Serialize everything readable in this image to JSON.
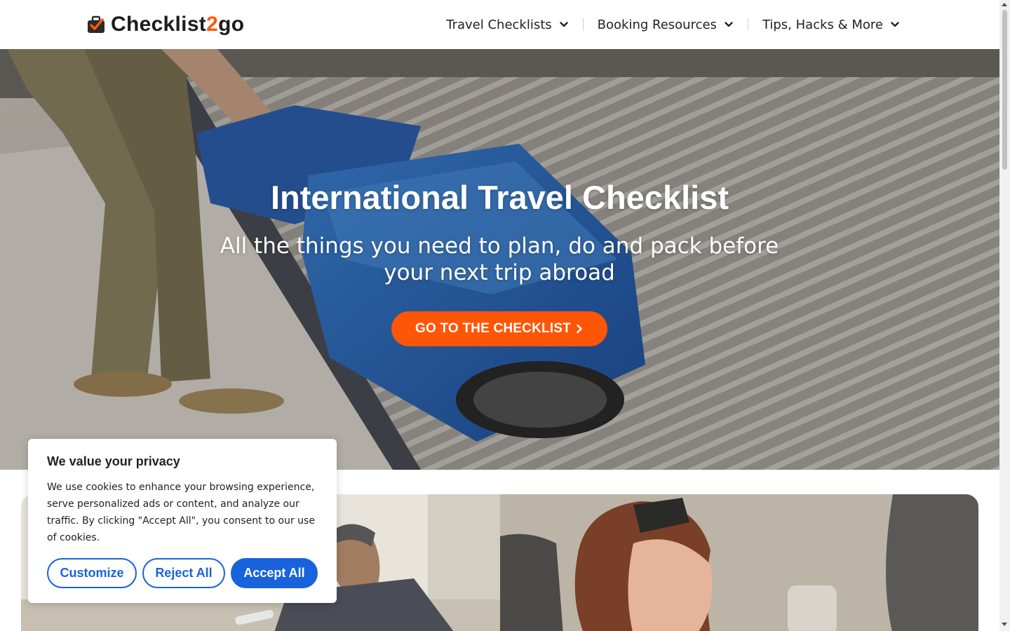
{
  "header": {
    "logo": {
      "text_main": "Checklist",
      "text_accent": "2",
      "text_end": "go",
      "icon": "suitcase-check-icon"
    },
    "nav": [
      {
        "label": "Travel Checklists",
        "icon": "chevron-down-icon"
      },
      {
        "label": "Booking Resources",
        "icon": "chevron-down-icon"
      },
      {
        "label": "Tips, Hacks & More",
        "icon": "chevron-down-icon"
      }
    ]
  },
  "hero": {
    "title": "International Travel Checklist",
    "subtitle": "All the things you need to plan, do and pack before your next trip abroad",
    "cta_label": "GO TO THE CHECKLIST",
    "cta_icon": "chevron-right-icon"
  },
  "cookie": {
    "title": "We value your privacy",
    "text": "We use cookies to enhance your browsing experience, serve personalized ads or content, and analyze our traffic. By clicking \"Accept All\", you consent to our use of cookies.",
    "customize_label": "Customize",
    "reject_label": "Reject All",
    "accept_label": "Accept All"
  },
  "colors": {
    "brand_orange": "#ff5507",
    "consent_blue": "#1863dc"
  }
}
